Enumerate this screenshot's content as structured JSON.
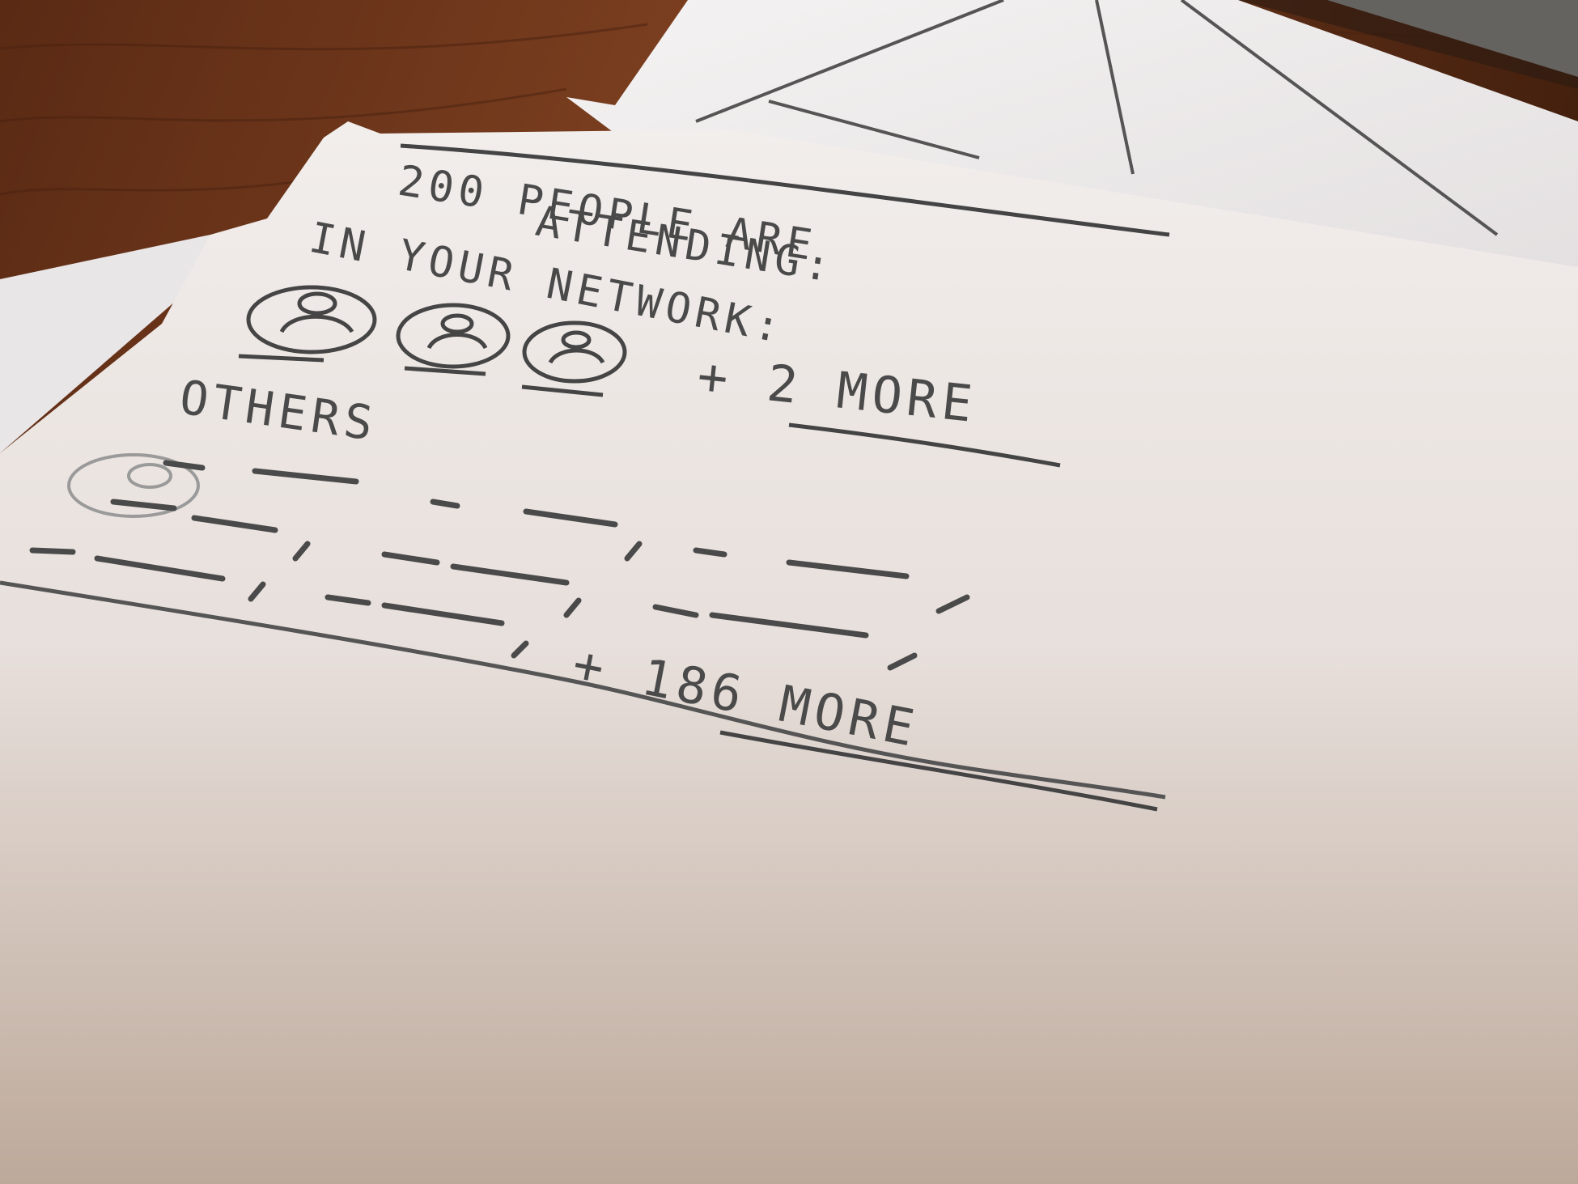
{
  "sketch": {
    "headline_line1": "200 PEOPLE ARE",
    "headline_line2": "ATTENDING:",
    "network_label": "IN YOUR NETWORK:",
    "network_more": "+ 2 MORE",
    "others_label": "OTHERS",
    "others_more": "+ 186 MORE"
  },
  "colors": {
    "table": "#6b3820",
    "paper": "#efe9e6",
    "pencil": "#4a4a4a",
    "monitor_stand": "#b9cbd0"
  }
}
